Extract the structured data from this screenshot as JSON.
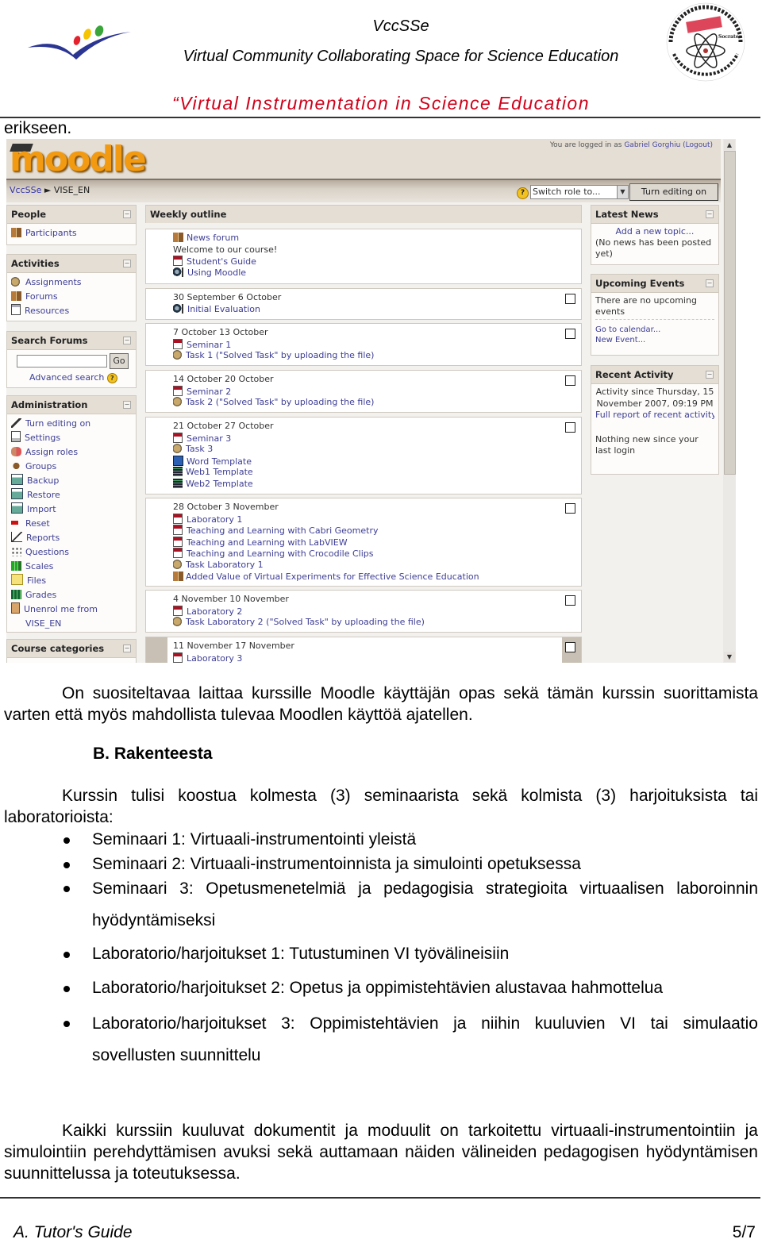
{
  "header": {
    "title": "VccSSe",
    "subtitle": "Virtual Community Collaborating Space for Science Education",
    "project_title": "“Virtual Instrumentation in Science Education",
    "left_logo": "eu-lifelong-learning-logo",
    "right_logo": "comenius-socrates-logo",
    "right_logo_text": [
      "Virtual Community Collaborating Space for Science Education",
      "COMENIUS",
      "Socrates"
    ]
  },
  "continuation_text": "erikseen.",
  "moodle": {
    "logo_text": "moodle",
    "login_prefix": "You are logged in as",
    "login_user": "Gabriel Gorghiu",
    "logout": "(Logout)",
    "breadcrumb": {
      "home": "VccSSe",
      "separator": "►",
      "course": "VISE_EN"
    },
    "switch_role": {
      "selected": "Switch role to..."
    },
    "turn_editing_button": "Turn editing on",
    "left_blocks": [
      {
        "title": "People",
        "items": [
          {
            "icon": "participants-icon",
            "label": "Participants"
          }
        ]
      },
      {
        "title": "Activities",
        "items": [
          {
            "icon": "assignments-icon",
            "label": "Assignments"
          },
          {
            "icon": "forums-icon",
            "label": "Forums"
          },
          {
            "icon": "resources-icon",
            "label": "Resources"
          }
        ]
      },
      {
        "title": "Search Forums",
        "search_value": "",
        "go_label": "Go",
        "advanced_search": "Advanced search"
      },
      {
        "title": "Administration",
        "items": [
          {
            "icon": "edit-icon",
            "label": "Turn editing on"
          },
          {
            "icon": "settings-icon",
            "label": "Settings"
          },
          {
            "icon": "assign-roles-icon",
            "label": "Assign roles"
          },
          {
            "icon": "groups-icon",
            "label": "Groups"
          },
          {
            "icon": "backup-icon",
            "label": "Backup"
          },
          {
            "icon": "restore-icon",
            "label": "Restore"
          },
          {
            "icon": "import-icon",
            "label": "Import"
          },
          {
            "icon": "reset-icon",
            "label": "Reset"
          },
          {
            "icon": "reports-icon",
            "label": "Reports"
          },
          {
            "icon": "questions-icon",
            "label": "Questions"
          },
          {
            "icon": "scales-icon",
            "label": "Scales"
          },
          {
            "icon": "files-icon",
            "label": "Files"
          },
          {
            "icon": "grades-icon",
            "label": "Grades"
          },
          {
            "icon": "unenrol-icon",
            "label": "Unenrol me from"
          },
          {
            "icon": "",
            "label": "VISE_EN"
          }
        ]
      },
      {
        "title": "Course categories"
      }
    ],
    "weekly_outline": {
      "title": "Weekly outline",
      "sections": [
        {
          "date": "",
          "items": [
            {
              "icon": "forum-icon",
              "label": "News forum",
              "link": true
            },
            {
              "icon": "",
              "label": "Welcome to our course!",
              "link": false
            },
            {
              "icon": "pdf-icon",
              "label": "Student's Guide",
              "link": true
            },
            {
              "icon": "web-icon",
              "label": "Using Moodle",
              "link": true
            }
          ]
        },
        {
          "date": "30 September 6 October",
          "items": [
            {
              "icon": "web-icon",
              "label": "Initial Evaluation",
              "link": true
            }
          ]
        },
        {
          "date": "7 October 13 October",
          "items": [
            {
              "icon": "pdf-icon",
              "label": "Seminar 1",
              "link": true
            },
            {
              "icon": "assignment-icon",
              "label": "Task 1 (\"Solved Task\" by uploading the file)",
              "link": true
            }
          ]
        },
        {
          "date": "14 October 20 October",
          "items": [
            {
              "icon": "pdf-icon",
              "label": "Seminar 2",
              "link": true
            },
            {
              "icon": "assignment-icon",
              "label": "Task 2 (\"Solved Task\" by uploading the file)",
              "link": true
            }
          ]
        },
        {
          "date": "21 October 27 October",
          "items": [
            {
              "icon": "pdf-icon",
              "label": "Seminar 3",
              "link": true
            },
            {
              "icon": "assignment-icon",
              "label": "Task 3",
              "link": true
            },
            {
              "icon": "word-icon",
              "label": "Word Template",
              "link": true
            },
            {
              "icon": "html-icon",
              "label": "Web1 Template",
              "link": true
            },
            {
              "icon": "html-icon",
              "label": "Web2 Template",
              "link": true
            }
          ]
        },
        {
          "date": "28 October 3 November",
          "items": [
            {
              "icon": "pdf-icon",
              "label": "Laboratory 1",
              "link": true
            },
            {
              "icon": "pdf-icon",
              "label": "Teaching and Learning with Cabri Geometry",
              "link": true
            },
            {
              "icon": "pdf-icon",
              "label": "Teaching and Learning with LabVIEW",
              "link": true
            },
            {
              "icon": "pdf-icon",
              "label": "Teaching and Learning with Crocodile Clips",
              "link": true
            },
            {
              "icon": "assignment-icon",
              "label": "Task Laboratory 1",
              "link": true
            },
            {
              "icon": "forum-icon",
              "label": "Added Value of Virtual Experiments for Effective Science Education",
              "link": true
            }
          ]
        },
        {
          "date": "4 November 10 November",
          "items": [
            {
              "icon": "pdf-icon",
              "label": "Laboratory 2",
              "link": true
            },
            {
              "icon": "assignment-icon",
              "label": "Task Laboratory 2 (\"Solved Task\" by uploading the file)",
              "link": true
            }
          ]
        },
        {
          "date": "11 November 17 November",
          "current": true,
          "items": [
            {
              "icon": "pdf-icon",
              "label": "Laboratory 3",
              "link": true
            }
          ]
        }
      ]
    },
    "right_blocks": {
      "latest_news": {
        "title": "Latest News",
        "add_topic": "Add a new topic...",
        "empty": "(No news has been posted yet)"
      },
      "upcoming_events": {
        "title": "Upcoming Events",
        "empty": "There are no upcoming events",
        "calendar_link": "Go to calendar...",
        "new_event_link": "New Event..."
      },
      "recent_activity": {
        "title": "Recent Activity",
        "since": "Activity since Thursday, 15 November 2007, 09:19 PM",
        "full_report": "Full report of recent activity...",
        "nothing_new": "Nothing new since your last login"
      }
    }
  },
  "body": {
    "para1": "On suositeltavaa laittaa kurssille Moodle käyttäjän opas sekä tämän kurssin suorittamista varten että myös mahdollista tulevaa Moodlen käyttöä ajatellen.",
    "heading": "B.  Rakenteesta",
    "para2": "Kurssin tulisi koostua kolmesta (3) seminaarista sekä kolmista (3) harjoituksista tai laboratorioista:",
    "bullets": [
      "Seminaari 1: Virtuaali-instrumentointi yleistä",
      "Seminaari 2: Virtuaali-instrumentoinnista ja simulointi opetuksessa",
      "Seminaari 3: Opetusmenetelmiä ja pedagogisia strategioita virtuaalisen laboroinnin hyödyntämiseksi",
      "Laboratorio/harjoitukset 1: Tutustuminen VI työvälineisiin",
      "Laboratorio/harjoitukset 2:  Opetus ja oppimistehtävien alustavaa hahmottelua",
      "Laboratorio/harjoitukset 3: Oppimistehtävien ja niihin kuuluvien VI tai simulaatio sovellusten suunnittelu"
    ],
    "para3": "Kaikki kurssiin kuuluvat dokumentit ja moduulit on tarkoitettu virtuaali-instrumentointiin ja simulointiin perehdyttämisen avuksi sekä auttamaan näiden välineiden pedagogisen hyödyntämisen suunnittelussa ja toteutuksessa."
  },
  "footer": {
    "left": "A. Tutor's Guide",
    "page": "5/7"
  }
}
